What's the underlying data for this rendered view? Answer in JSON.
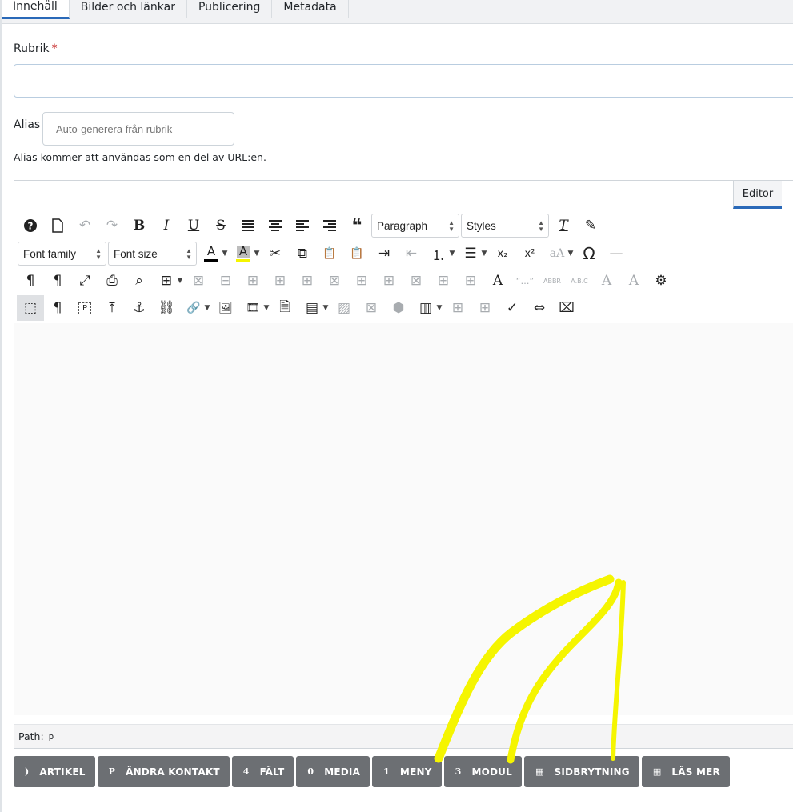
{
  "tabs": [
    {
      "label": "Innehåll",
      "active": true
    },
    {
      "label": "Bilder och länkar"
    },
    {
      "label": "Publicering"
    },
    {
      "label": "Metadata"
    }
  ],
  "form": {
    "rubrik_label": "Rubrik",
    "required_mark": "*",
    "rubrik_value": "",
    "alias_label": "Alias",
    "alias_placeholder": "Auto-generera från rubrik",
    "alias_help": "Alias kommer att användas som en del av URL:en."
  },
  "editor": {
    "toggle_label": "Editor",
    "block_format": "Paragraph",
    "styles": "Styles",
    "font_family": "Font family",
    "font_size": "Font size",
    "path_label": "Path:",
    "path_value": "p",
    "text_color": "#000000",
    "highlight_color": "#f5f500"
  },
  "toolbar_glyphs": {
    "help": "?",
    "newdoc": "🗋",
    "undo": "↶",
    "redo": "↷",
    "bold": "B",
    "italic": "I",
    "underline": "U",
    "strike": "S",
    "justify": "≣",
    "center": "≡",
    "left": "≡",
    "right": "≡",
    "quote": "❝",
    "clearfmt": "T",
    "brush": "✎",
    "fcolor": "A",
    "bcolor": "A",
    "cut": "✂",
    "copy": "⧉",
    "paste": "📋",
    "pastetext": "📋",
    "indent": "⇥",
    "outdent": "⇤",
    "numlist": "⒈",
    "bullist": "☰",
    "sub": "x₂",
    "sup": "x²",
    "case": "aA",
    "omega": "Ω",
    "hr": "—",
    "ltr": "¶",
    "rtl": "¶",
    "fullscreen": "⤢",
    "print": "⎙",
    "search": "⌕",
    "table": "⊞",
    "t1": "⊠",
    "t2": "⊟",
    "t3": "⊞",
    "t4": "⊞",
    "t5": "⊞",
    "t6": "⊠",
    "t7": "⊞",
    "t8": "⊞",
    "t9": "⊠",
    "t10": "⊞",
    "t11": "⊞",
    "aa": "A",
    "quotes": "“…”",
    "abbr": "ABBR",
    "acronym": "A.B.C",
    "a1": "A",
    "a2": "A",
    "gear": "⚙",
    "vis": "⬚",
    "pilcrow": "¶",
    "pblock": "P",
    "upload": "⤒",
    "anchor": "⚓",
    "unlink": "⛓",
    "link": "🔗",
    "image": "🖼",
    "media": "🎞",
    "doc": "🗎",
    "template": "▤",
    "img2": "▨",
    "del": "⊠",
    "cube": "⬢",
    "cols": "▥",
    "b1": "⊞",
    "b2": "⊞",
    "spell": "✓",
    "pagebreak": "⇔",
    "nonbreak": "⌧"
  },
  "xtd_buttons": [
    {
      "icon": ")",
      "label": "ARTIKEL"
    },
    {
      "icon": "P",
      "label": "ÄNDRA KONTAKT"
    },
    {
      "icon": "4",
      "label": "FÄLT"
    },
    {
      "icon": "0",
      "label": "MEDIA"
    },
    {
      "icon": "1",
      "label": "MENY"
    },
    {
      "icon": "3",
      "label": "MODUL"
    },
    {
      "icon": "▦",
      "label": "SIDBRYTNING"
    },
    {
      "icon": "▦",
      "label": "LÄS MER"
    }
  ],
  "colors": {
    "accent": "#2a69b8",
    "annotation": "#f5f500",
    "button_bg": "#6c6f73"
  }
}
